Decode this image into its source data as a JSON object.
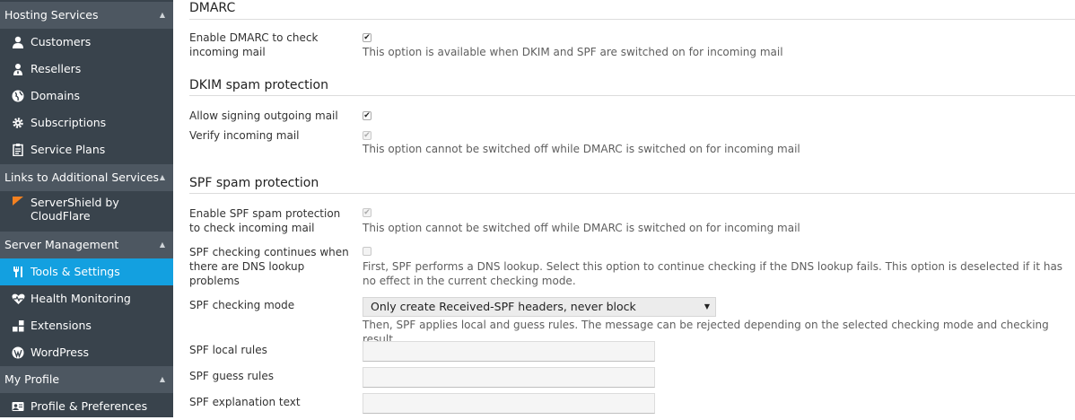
{
  "sidebar": {
    "sections": [
      {
        "title": "Hosting Services",
        "items": [
          {
            "label": "Customers",
            "icon": "user-icon"
          },
          {
            "label": "Resellers",
            "icon": "reseller-icon"
          },
          {
            "label": "Domains",
            "icon": "globe-icon"
          },
          {
            "label": "Subscriptions",
            "icon": "gear-icon"
          },
          {
            "label": "Service Plans",
            "icon": "clipboard-icon"
          }
        ]
      },
      {
        "title": "Links to Additional Services",
        "items": [
          {
            "label": "ServerShield by CloudFlare",
            "icon": "cloudflare-icon"
          }
        ]
      },
      {
        "title": "Server Management",
        "items": [
          {
            "label": "Tools & Settings",
            "icon": "tools-icon",
            "active": true
          },
          {
            "label": "Health Monitoring",
            "icon": "heart-pulse-icon"
          },
          {
            "label": "Extensions",
            "icon": "extensions-icon"
          },
          {
            "label": "WordPress",
            "icon": "wordpress-icon"
          }
        ]
      },
      {
        "title": "My Profile",
        "items": [
          {
            "label": "Profile & Preferences",
            "icon": "profile-icon"
          }
        ]
      }
    ],
    "accent_color": "#13a0e0"
  },
  "dmarc": {
    "heading": "DMARC",
    "enable_label": "Enable DMARC to check incoming mail",
    "enable_checked": true,
    "enable_hint": "This option is available when DKIM and SPF are switched on for incoming mail"
  },
  "dkim": {
    "heading": "DKIM spam protection",
    "signing_label": "Allow signing outgoing mail",
    "signing_checked": true,
    "verify_label": "Verify incoming mail",
    "verify_checked": true,
    "verify_disabled": true,
    "verify_hint": "This option cannot be switched off while DMARC is switched on for incoming mail"
  },
  "spf": {
    "heading": "SPF spam protection",
    "enable_label": "Enable SPF spam protection to check incoming mail",
    "enable_checked": true,
    "enable_disabled": true,
    "enable_hint": "This option cannot be switched off while DMARC is switched on for incoming mail",
    "continue_label": "SPF checking continues when there are DNS lookup problems",
    "continue_checked": false,
    "continue_hint": "First, SPF performs a DNS lookup. Select this option to continue checking if the DNS lookup fails. This option is deselected if it has no effect in the current checking mode.",
    "mode_label": "SPF checking mode",
    "mode_value": "Only create Received-SPF headers, never block",
    "mode_hint": "Then, SPF applies local and guess rules. The message can be rejected depending on the selected checking mode and checking result.",
    "local_rules_label": "SPF local rules",
    "local_rules_value": "",
    "guess_rules_label": "SPF guess rules",
    "guess_rules_value": "",
    "explanation_label": "SPF explanation text",
    "explanation_value": ""
  }
}
